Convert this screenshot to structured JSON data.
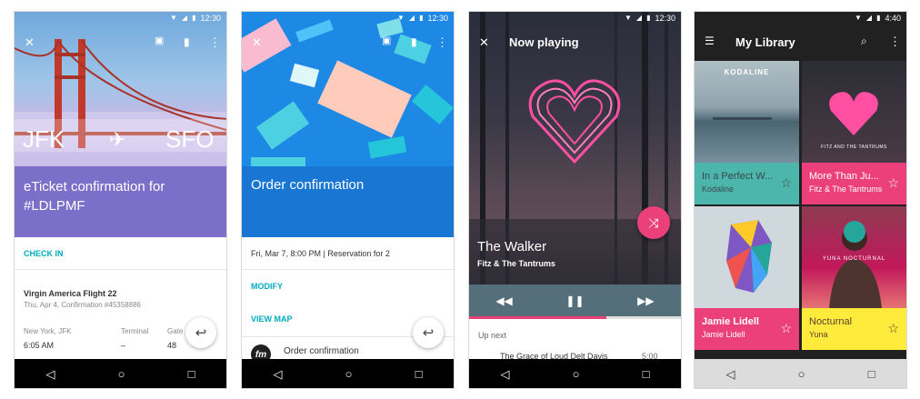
{
  "status_bar": {
    "time_1": "12:30",
    "time_2": "12:30",
    "time_3": "12:30",
    "time_4": "4:40",
    "wifi_icon": "wifi-icon",
    "signal_icon": "signal-icon",
    "battery_icon": "battery-icon"
  },
  "nav_bar": {
    "back": "◁",
    "home": "○",
    "recents": "□"
  },
  "phone1": {
    "from": "JFK",
    "plane": "✈",
    "to": "SFO",
    "title": "eTicket confirmation for #LDLPMF",
    "check_in": "CHECK IN",
    "flight": "Virgin America Flight 22",
    "flight_sub": "Thu, Apr 4, Confirmation #45358886",
    "col1_label": "New York, JFK",
    "col1_value": "6:05 AM",
    "col2_label": "Terminal",
    "col2_value": "–",
    "col3_label": "Gate",
    "col3_value": "48",
    "colors": {
      "header": "#7b6fc9",
      "accent": "#00acc1"
    }
  },
  "phone2": {
    "title": "Order confirmation",
    "reservation": "Fri, Mar 7, 8:00 PM | Reservation for 2",
    "modify": "MODIFY",
    "view_map": "VIEW MAP",
    "footer_item": "Order confirmation",
    "logo_text": "fm",
    "colors": {
      "header": "#1976d2",
      "accent": "#00acc1"
    }
  },
  "phone3": {
    "toolbar_title": "Now playing",
    "song": "The Walker",
    "artist": "Fitz & The Tantrums",
    "up_next": "Up next",
    "next_track": "The Grace of Loud Delt Davis",
    "next_time": "5:00",
    "progress": 0.65,
    "colors": {
      "fab": "#ec407a",
      "controls": "#546e7a",
      "progress": "#ec407a"
    }
  },
  "phone4": {
    "title": "My Library",
    "albums": [
      {
        "title": "In a Perfect W...",
        "artist": "Kodaline",
        "cover_text": "KODALINE",
        "bg": "#4db6ac",
        "fg": "#37474f"
      },
      {
        "title": "More Than Ju...",
        "artist": "Fitz & The Tantrums",
        "cover_text": "FITZ AND THE TANTRUMS",
        "bg": "#ec407a",
        "fg": "#ffffff"
      },
      {
        "title": "Jamie Lidell",
        "artist": "Jamie Lidell",
        "bg": "#ec407a",
        "fg": "#ffffff"
      },
      {
        "title": "Nocturnal",
        "artist": "Yuna",
        "cover_text": "YUNA NOCTURNAL",
        "bg": "#ffeb3b",
        "fg": "#5d4037"
      }
    ],
    "colors": {
      "toolbar": "#212121"
    }
  }
}
